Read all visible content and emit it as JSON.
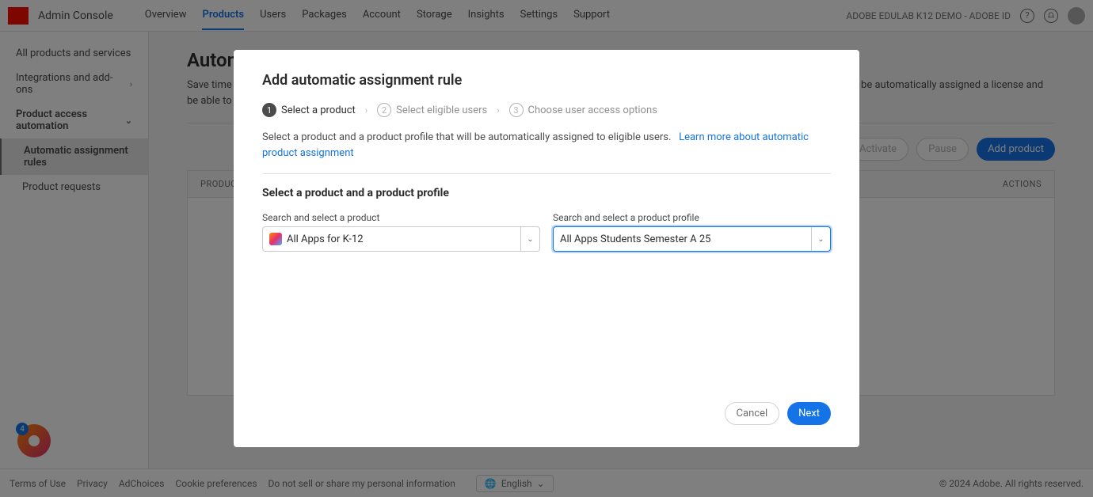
{
  "header": {
    "app_name": "Admin Console",
    "nav": {
      "overview": "Overview",
      "products": "Products",
      "users": "Users",
      "packages": "Packages",
      "account": "Account",
      "storage": "Storage",
      "insights": "Insights",
      "settings": "Settings",
      "support": "Support"
    },
    "org_name": "ADOBE EDULAB K12 DEMO - ADOBE ID"
  },
  "sidebar": {
    "items": [
      "All products and services",
      "Integrations and add-ons",
      "Product access automation",
      "Automatic assignment rules",
      "Product requests"
    ]
  },
  "page": {
    "title": "Automatic assignment rules",
    "description": "Save time and give eligible users on-demand access to a product by creating product automatic assignment rules. Any user who matches a rule will be automatically assigned a license and be able to access, download and start using the product.",
    "learn_more": "Learn more about automatic product assignment",
    "buttons": {
      "activate": "Activate",
      "pause": "Pause",
      "add_product": "Add product"
    },
    "table": {
      "col_product": "PRODUCT",
      "col_actions": "ACTIONS"
    }
  },
  "modal": {
    "title": "Add automatic assignment rule",
    "steps": [
      {
        "num": "1",
        "label": "Select a product"
      },
      {
        "num": "2",
        "label": "Select eligible users"
      },
      {
        "num": "3",
        "label": "Choose user access options"
      }
    ],
    "subtext": "Select a product and a product profile that will be automatically assigned to eligible users.",
    "subtext_link": "Learn more about automatic product assignment",
    "section_title": "Select a product and a product profile",
    "product_field": {
      "label": "Search and select a product",
      "value": "All Apps for K-12"
    },
    "profile_field": {
      "label": "Search and select a product profile",
      "value": "All Apps Students Semester A 25"
    },
    "buttons": {
      "cancel": "Cancel",
      "next": "Next"
    }
  },
  "walkme": {
    "count": "4"
  },
  "footer": {
    "links": [
      "Terms of Use",
      "Privacy",
      "AdChoices",
      "Cookie preferences",
      "Do not sell or share my personal information"
    ],
    "language": "English",
    "copyright": "© 2024 Adobe. All rights reserved."
  }
}
